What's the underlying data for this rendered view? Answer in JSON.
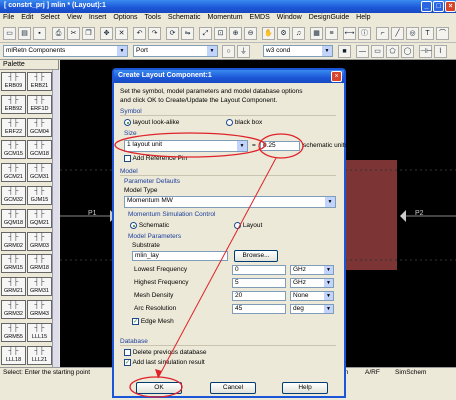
{
  "window": {
    "title": "[ constrt_prj ] mlin * (Layout):1"
  },
  "menu": [
    "File",
    "Edit",
    "Select",
    "View",
    "Insert",
    "Options",
    "Tools",
    "Schematic",
    "Momentum",
    "EMDS",
    "Window",
    "DesignGuide",
    "Help"
  ],
  "toolbar2": {
    "palette_select": "mlRetn Components",
    "port_select": "Port",
    "layer_select": "w3 cond"
  },
  "palette": {
    "title": "Palette",
    "items": [
      "ERB09",
      "ERB21",
      "ERB92",
      "ERF1D",
      "ERF22",
      "GCM04",
      "GCM15",
      "GCM18",
      "GCM21",
      "GCM31",
      "GCM32",
      "GJM15",
      "GQM18",
      "GQM21",
      "GRM02",
      "GRM03",
      "GRM15",
      "GRM18",
      "GRM21",
      "GRM31",
      "GRM32",
      "GRM43",
      "GRM55",
      "LLL15",
      "LLL18",
      "LLL21"
    ]
  },
  "canvas": {
    "port1": "P1",
    "port2": "P2"
  },
  "status": {
    "left": "Select: Enter the starting point",
    "right1": "sum",
    "right2": "A/RF",
    "right3": "SimSchem"
  },
  "dialog": {
    "title": "Create Layout Component:1",
    "intro1": "Set the symbol, model parameters and model database options",
    "intro2": "and click OK to Create/Update the Layout Component.",
    "symbol_section": "Symbol",
    "radio_look": "layout look-alike",
    "radio_black": "black box",
    "size_label": "Size",
    "size_select": "1 layout unit",
    "equals": "=",
    "size_value": "0.25",
    "size_units": "schematic units",
    "add_ref_pin": "Add Reference Pin",
    "model_section": "Model",
    "param_defaults": "Parameter Defaults",
    "model_type_label": "Model Type",
    "model_type": "Momentum MW",
    "msc_label": "Momentum Simulation Control",
    "radio_schematic": "Schematic",
    "radio_layout": "Layout",
    "model_params": "Model Parameters",
    "substrate_label": "Substrate",
    "substrate_value": "mlin_lay",
    "browse": "Browse...",
    "params": [
      {
        "name": "Lowest Frequency",
        "value": "0",
        "unit": "GHz"
      },
      {
        "name": "Highest Frequency",
        "value": "5",
        "unit": "GHz"
      },
      {
        "name": "Mesh Density",
        "value": "20",
        "unit": "None"
      },
      {
        "name": "Arc Resolution",
        "value": "45",
        "unit": "deg"
      }
    ],
    "edge_mesh": "Edge Mesh",
    "database_section": "Database",
    "delete_db": "Delete previous database",
    "add_last": "Add last simulation result",
    "ok": "OK",
    "cancel": "Cancel",
    "help": "Help"
  },
  "colors": {
    "annotation": "#e0222a",
    "substrate_fill": "#6b2a2a"
  }
}
